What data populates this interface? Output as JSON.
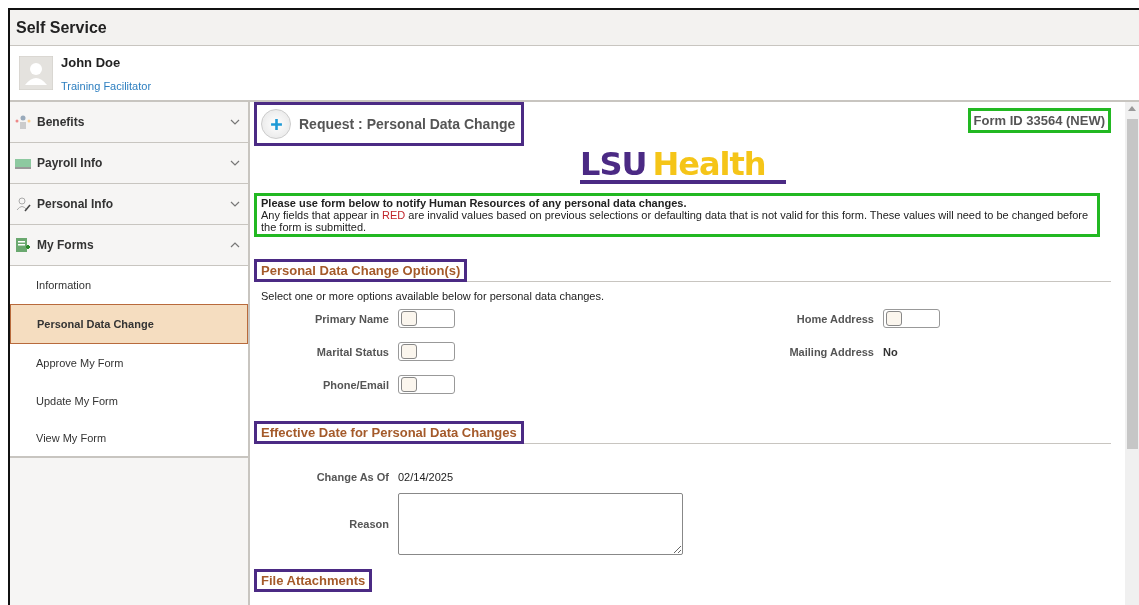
{
  "header": {
    "title": "Self Service"
  },
  "profile": {
    "name": "John Doe",
    "role": "Training Facilitator"
  },
  "sidebar": {
    "groups": [
      {
        "label": "Benefits",
        "kind": "benefits",
        "expanded": false
      },
      {
        "label": "Payroll Info",
        "kind": "payroll",
        "expanded": false
      },
      {
        "label": "Personal Info",
        "kind": "personal",
        "expanded": false
      },
      {
        "label": "My Forms",
        "kind": "forms",
        "expanded": true,
        "children": [
          {
            "label": "Information",
            "selected": false
          },
          {
            "label": "Personal Data Change",
            "selected": true
          },
          {
            "label": "Approve My Form",
            "selected": false
          },
          {
            "label": "Update My Form",
            "selected": false
          },
          {
            "label": "View My Form",
            "selected": false
          }
        ]
      }
    ]
  },
  "page": {
    "title": "Request :  Personal Data Change",
    "form_id": "Form ID 33564 (NEW)",
    "logo": {
      "left": "LSU",
      "right": "Health"
    },
    "notice": {
      "heading": "Please use form below to notify Human Resources of any personal data changes.",
      "before": "Any fields that appear in ",
      "red": "RED",
      "after": " are invalid values based on previous selections or defaulting data that is not valid for this form.  These values will need to be changed before the form is submitted."
    },
    "options_section": {
      "heading": "Personal Data Change Option(s)",
      "intro": "Select one or more options available below for personal data changes.",
      "left": [
        {
          "label": "Primary Name",
          "kind": "toggle",
          "on": false
        },
        {
          "label": "Marital Status",
          "kind": "toggle",
          "on": false
        },
        {
          "label": "Phone/Email",
          "kind": "toggle",
          "on": false
        }
      ],
      "right": [
        {
          "label": "Home Address",
          "kind": "toggle",
          "on": false
        },
        {
          "label": "Mailing Address",
          "kind": "text",
          "value": "No"
        }
      ]
    },
    "effective_section": {
      "heading": "Effective Date for Personal Data Changes",
      "change_as_of_label": "Change As Of",
      "change_as_of": "02/14/2025",
      "reason_label": "Reason"
    },
    "attachments_section": {
      "heading": "File Attachments"
    }
  }
}
